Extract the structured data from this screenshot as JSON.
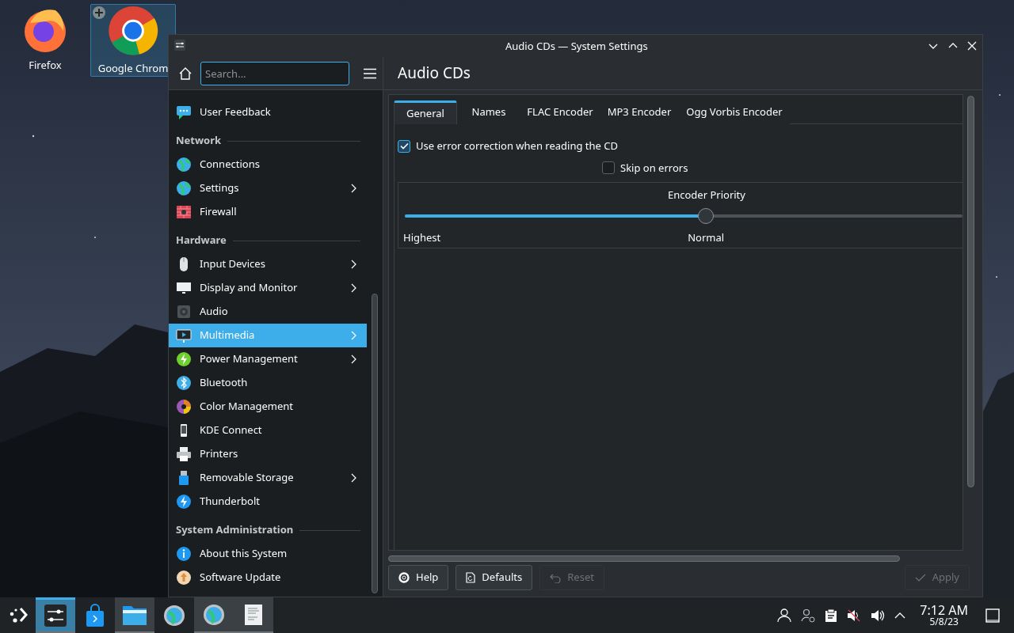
{
  "desktop_icons": [
    {
      "label": "Firefox",
      "selected": false
    },
    {
      "label": "Google Chrom",
      "selected": true
    }
  ],
  "window": {
    "title": "Audio CDs — System Settings"
  },
  "search": {
    "placeholder": "Search..."
  },
  "sidebar": {
    "sections": [
      {
        "items": [
          {
            "label": "User Feedback",
            "has_children": false,
            "selected": false
          }
        ]
      },
      {
        "title": "Network",
        "items": [
          {
            "label": "Connections",
            "has_children": false,
            "selected": false
          },
          {
            "label": "Settings",
            "has_children": true,
            "selected": false
          },
          {
            "label": "Firewall",
            "has_children": false,
            "selected": false
          }
        ]
      },
      {
        "title": "Hardware",
        "items": [
          {
            "label": "Input Devices",
            "has_children": true,
            "selected": false
          },
          {
            "label": "Display and Monitor",
            "has_children": true,
            "selected": false
          },
          {
            "label": "Audio",
            "has_children": false,
            "selected": false
          },
          {
            "label": "Multimedia",
            "has_children": true,
            "selected": true
          },
          {
            "label": "Power Management",
            "has_children": true,
            "selected": false
          },
          {
            "label": "Bluetooth",
            "has_children": false,
            "selected": false
          },
          {
            "label": "Color Management",
            "has_children": false,
            "selected": false
          },
          {
            "label": "KDE Connect",
            "has_children": false,
            "selected": false
          },
          {
            "label": "Printers",
            "has_children": false,
            "selected": false
          },
          {
            "label": "Removable Storage",
            "has_children": true,
            "selected": false
          },
          {
            "label": "Thunderbolt",
            "has_children": false,
            "selected": false
          }
        ]
      },
      {
        "title": "System Administration",
        "items": [
          {
            "label": "About this System",
            "has_children": false,
            "selected": false
          },
          {
            "label": "Software Update",
            "has_children": false,
            "selected": false
          }
        ]
      }
    ]
  },
  "page": {
    "title": "Audio CDs",
    "tabs": [
      {
        "label": "General",
        "selected": true
      },
      {
        "label": "Names",
        "selected": false
      },
      {
        "label": "FLAC Encoder",
        "selected": false
      },
      {
        "label": "MP3 Encoder",
        "selected": false
      },
      {
        "label": "Ogg Vorbis Encoder",
        "selected": false
      }
    ],
    "checkboxes": [
      {
        "label": "Use error correction when reading the CD",
        "checked": true
      },
      {
        "label": "Skip on errors",
        "checked": false
      }
    ],
    "priority": {
      "title": "Encoder Priority",
      "level": 0.54,
      "low_label": "Highest",
      "mid_label": "Normal"
    },
    "buttons": [
      {
        "label": "Help",
        "disabled": false
      },
      {
        "label": "Defaults",
        "disabled": false
      },
      {
        "label": "Reset",
        "disabled": true
      }
    ],
    "apply": {
      "label": "Apply",
      "disabled": true
    }
  },
  "taskbar": {
    "tasks": [
      {
        "active": true,
        "open": true
      },
      {
        "active": false,
        "open": false
      },
      {
        "active": false,
        "open": true
      },
      {
        "active": false,
        "open": false
      },
      {
        "active": false,
        "open": true
      },
      {
        "active": false,
        "open": true
      }
    ],
    "clock": {
      "time": "7:12 AM",
      "date": "5/8/23"
    }
  }
}
